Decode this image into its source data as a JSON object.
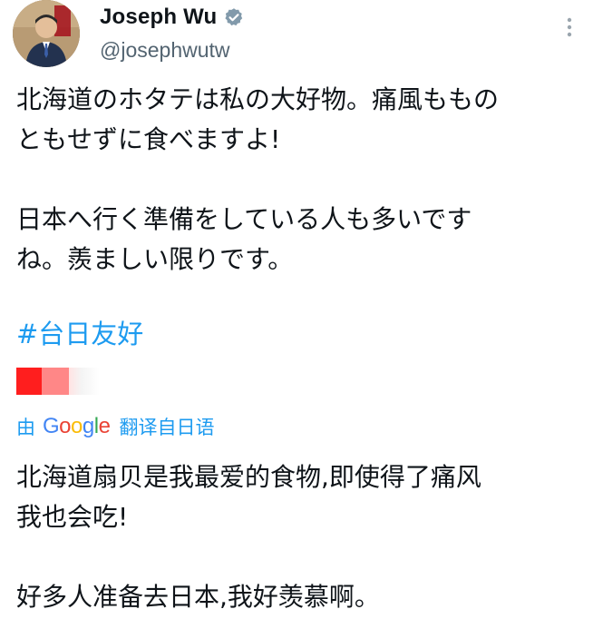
{
  "tweet": {
    "author": {
      "display_name": "Joseph Wu",
      "handle": "@josephwutw",
      "verified_icon": "verified-badge-icon",
      "avatar_icon": "profile-avatar"
    },
    "more_icon": "more-vertical-icon",
    "text": {
      "para1_line1": "北海道のホタテは私の大好物。痛風もものとも",
      "para1_line1_a": "北海道のホタテは私の大好物。痛風ももの",
      "para1_line2": "ともせずに食べますよ!",
      "para2_line1": "日本へ行く準備をしている人も多いです",
      "para2_line2": "ね。羨ましい限りです。",
      "hashtag": "#台日友好"
    },
    "translation": {
      "by_label": "由",
      "provider_G": "G",
      "provider_o1": "o",
      "provider_o2": "o",
      "provider_g": "g",
      "provider_l": "l",
      "provider_e": "e",
      "action_label": "翻译自日语",
      "para1_line1": "北海道扇贝是我最爱的食物,即使得了痛风",
      "para1_line2": "我也会吃!",
      "para2_line1": "好多人准备去日本,我好羡慕啊。"
    },
    "colors": {
      "link": "#1d9bf0",
      "text": "#0f1419",
      "secondary": "#536471",
      "redaction": "#ff1e1e"
    }
  }
}
